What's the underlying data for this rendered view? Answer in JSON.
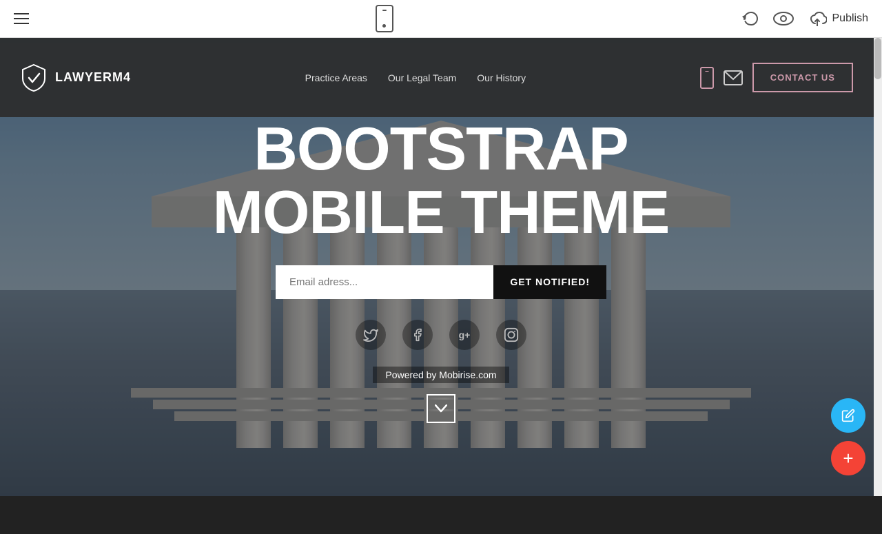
{
  "editor": {
    "publish_label": "Publish",
    "undo_title": "Undo",
    "preview_title": "Preview",
    "cloud_icon": "☁",
    "phone_icon": "📱"
  },
  "site": {
    "logo_name": "LAWYERM4",
    "nav_items": [
      {
        "label": "Practice Areas",
        "id": "practice-areas"
      },
      {
        "label": "Our Legal Team",
        "id": "our-legal-team"
      },
      {
        "label": "Our History",
        "id": "our-history"
      }
    ],
    "contact_btn": "CONTACT US"
  },
  "hero": {
    "title_line1": "BOOTSTRAP",
    "title_line2": "MOBILE THEME",
    "email_placeholder": "Email adress...",
    "notify_btn": "GET NOTIFIED!",
    "powered_by": "Powered by Mobirise.com"
  },
  "social": {
    "twitter": "𝕏",
    "facebook": "f",
    "google_plus": "g+",
    "instagram": "◻"
  },
  "fab": {
    "edit_icon": "✏",
    "add_icon": "+"
  }
}
